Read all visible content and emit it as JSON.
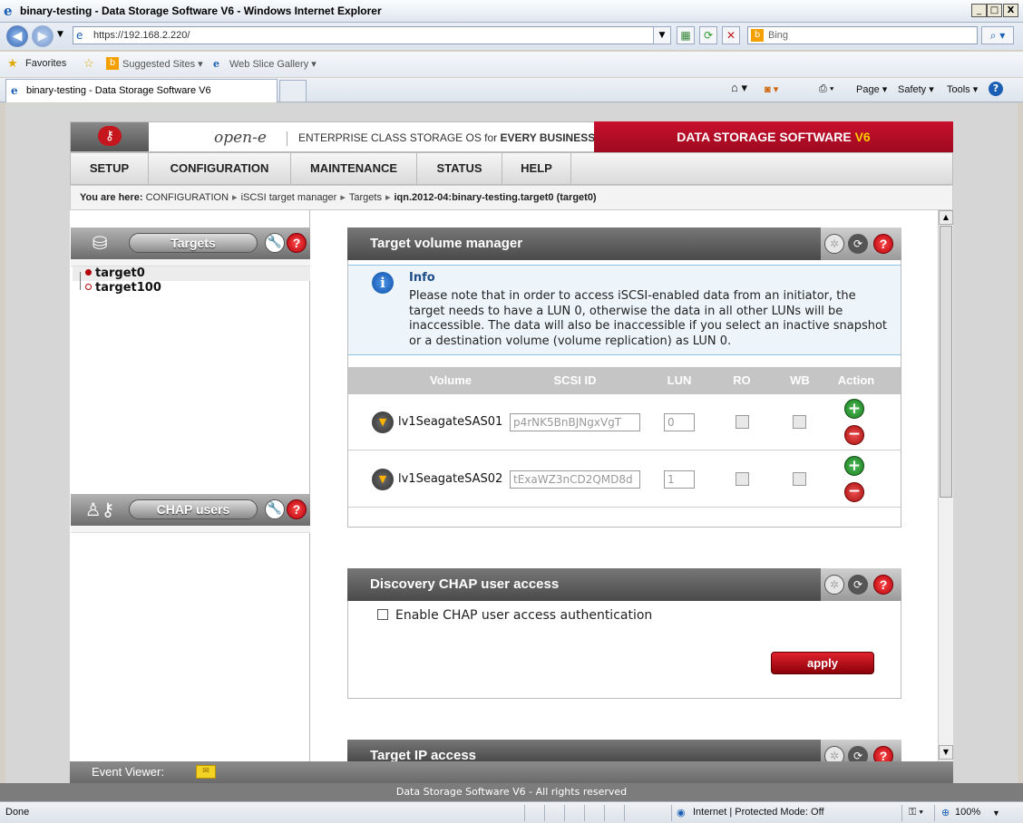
{
  "window": {
    "title": "binary-testing - Data Storage Software V6 - Windows Internet Explorer",
    "min": "_",
    "max": "□",
    "close": "X"
  },
  "browser": {
    "address": "https://192.168.2.220/",
    "search_placeholder": "Bing",
    "favorites_label": "Favorites",
    "suggested_sites": "Suggested Sites ▾",
    "web_slice": "Web Slice Gallery ▾",
    "tab_title": "binary-testing - Data Storage Software V6",
    "cmd_page": "Page ▾",
    "cmd_safety": "Safety ▾",
    "cmd_tools": "Tools ▾",
    "help": "?"
  },
  "app": {
    "brand": "open-e",
    "tagline_prefix": "ENTERPRISE CLASS STORAGE OS for ",
    "tagline_bold": "EVERY BUSINESS",
    "product": "DATA STORAGE SOFTWARE ",
    "product_version": "V6",
    "menu": [
      "SETUP",
      "CONFIGURATION",
      "MAINTENANCE",
      "STATUS",
      "HELP"
    ],
    "breadcrumb": {
      "label": "You are here:",
      "items": [
        "CONFIGURATION",
        "iSCSI target manager",
        "Targets"
      ],
      "current": "iqn.2012-04:binary-testing.target0 (target0)"
    }
  },
  "left": {
    "targets_title": "Targets",
    "targets": [
      "target0",
      "target100"
    ],
    "chap_title": "CHAP users"
  },
  "volume_manager": {
    "title": "Target volume manager",
    "info_title": "Info",
    "info_text": "Please note that in order to access iSCSI-enabled data from an initiator, the target needs to have a LUN 0, otherwise the data in all other LUNs will be inaccessible. The data will also be inaccessible if you select an inactive snapshot or a destination volume (volume replication) as LUN 0.",
    "columns": [
      "Volume",
      "SCSI ID",
      "LUN",
      "RO",
      "WB",
      "Action"
    ],
    "rows": [
      {
        "volume": "lv1SeagateSAS01",
        "scsi_id": "p4rNK5BnBJNgxVgT",
        "lun": "0"
      },
      {
        "volume": "lv1SeagateSAS02",
        "scsi_id": "tExaWZ3nCD2QMD8d",
        "lun": "1"
      }
    ]
  },
  "discovery": {
    "title": "Discovery CHAP user access",
    "checkbox_label": "Enable CHAP user access authentication",
    "apply": "apply"
  },
  "ip_access": {
    "title": "Target IP access"
  },
  "bottom": {
    "event_viewer": "Event Viewer:",
    "footer": "Data Storage Software V6 - All rights reserved",
    "status_done": "Done",
    "status_zone": "Internet | Protected Mode: Off",
    "zoom": "100%"
  }
}
